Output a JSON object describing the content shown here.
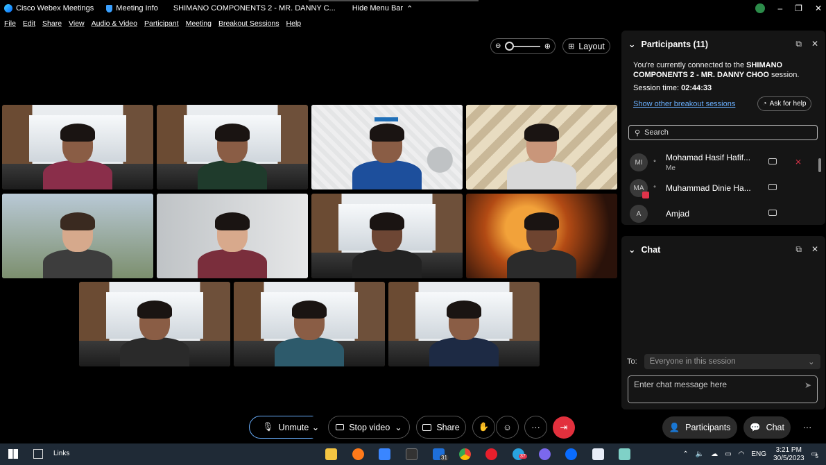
{
  "titlebar": {
    "app_name": "Cisco Webex Meetings",
    "meeting_info": "Meeting Info",
    "meeting_title": "SHIMANO COMPONENTS 2 - MR. DANNY C...",
    "hide_menu": "Hide Menu Bar",
    "minimize": "–",
    "restore": "❐",
    "close": "✕"
  },
  "menu": [
    "File",
    "Edit",
    "Share",
    "View",
    "Audio & Video",
    "Participant",
    "Meeting",
    "Breakout Sessions",
    "Help"
  ],
  "view": {
    "layout_label": "Layout"
  },
  "participants_panel": {
    "title": "Participants (11)",
    "info_prefix": "You're currently connected to the ",
    "session_name": "SHIMANO COMPONENTS 2 - MR. DANNY CHOO",
    "info_suffix": " session.",
    "session_time_label": "Session time: ",
    "session_time": "02:44:33",
    "breakout_link": "Show other breakout sessions",
    "ask_help": "Ask for help",
    "search_placeholder": "Search",
    "list": [
      {
        "initials": "MI",
        "name": "Mohamad Hasif Hafif...",
        "sub": "Me"
      },
      {
        "initials": "MA",
        "name": "Muhammad Dinie Ha...",
        "sub": ""
      },
      {
        "initials": "A",
        "name": "Amjad",
        "sub": ""
      }
    ]
  },
  "chat_panel": {
    "title": "Chat",
    "to_label": "To:",
    "to_value": "Everyone in this session",
    "input_placeholder": "Enter chat message here"
  },
  "controls": {
    "unmute": "Unmute",
    "stop_video": "Stop video",
    "share": "Share",
    "more": "···",
    "participants_tab": "Participants",
    "chat_tab": "Chat",
    "overflow": "···"
  },
  "taskbar": {
    "search_label": "Links",
    "mail_badge": "31",
    "telegram_badge": "37",
    "language": "ENG",
    "time": "3:21 PM",
    "date": "30/5/2023",
    "notification_count": "5"
  },
  "colors": {
    "accent_blue": "#6ab0ff",
    "end_red": "#e2303d",
    "panel_bg": "#151515",
    "taskbar_bg": "#1f2a36"
  }
}
